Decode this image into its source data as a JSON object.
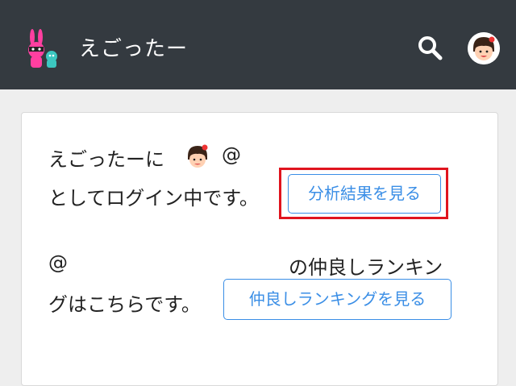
{
  "header": {
    "app_title": "えごったー",
    "logo_icon": "bunny-logo-icon",
    "search_icon": "search-icon",
    "avatar_icon": "user-avatar-icon"
  },
  "card": {
    "line1_prefix": "えごったーに",
    "line1_at": "@",
    "line2_text": "としてログイン中です。",
    "analyze_button": "分析結果を見る",
    "line3_at": "@",
    "line3_suffix": "の仲良しランキン",
    "line4_text": "グはこちらです。",
    "ranking_button": "仲良しランキングを見る"
  },
  "colors": {
    "header_bg": "#343a40",
    "accent": "#3a8ee6",
    "highlight": "#e0141e"
  }
}
